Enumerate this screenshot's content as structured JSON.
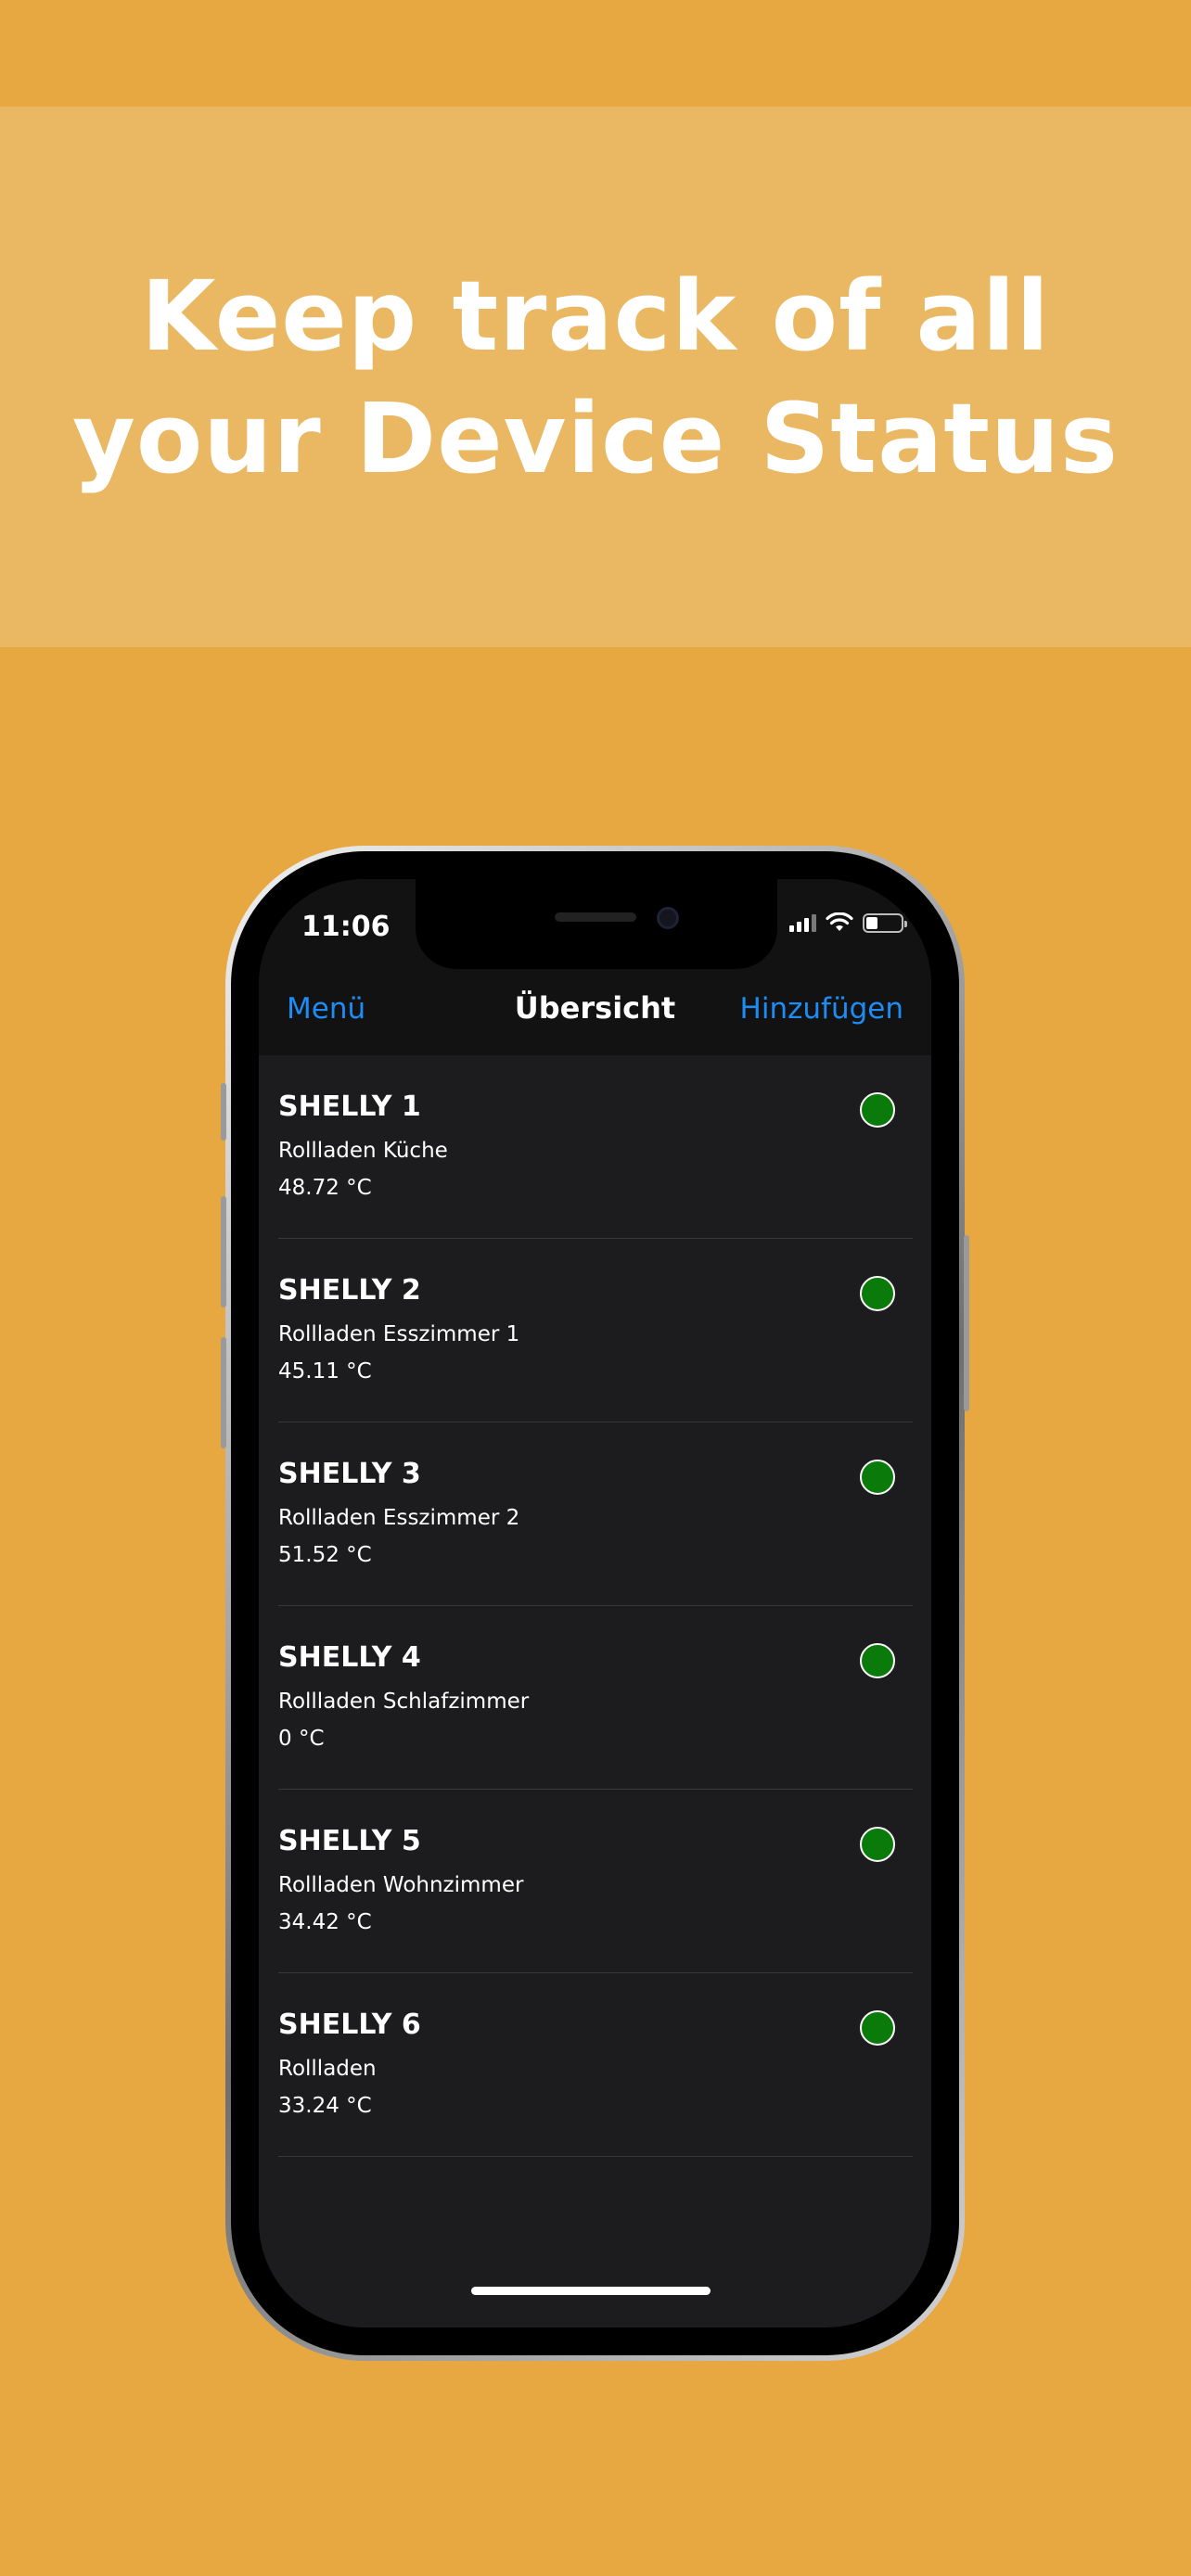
{
  "headline": "Keep track of all\nyour Device Status",
  "status_bar": {
    "time": "11:06"
  },
  "navbar": {
    "left": "Menü",
    "title": "Übersicht",
    "right": "Hinzufügen"
  },
  "devices": [
    {
      "name": "SHELLY 1",
      "room": "Rollladen Küche",
      "temp": "48.72 °C",
      "status": "online"
    },
    {
      "name": "SHELLY 2",
      "room": "Rollladen Esszimmer 1",
      "temp": "45.11 °C",
      "status": "online"
    },
    {
      "name": "SHELLY 3",
      "room": "Rollladen Esszimmer 2",
      "temp": "51.52 °C",
      "status": "online"
    },
    {
      "name": "SHELLY 4",
      "room": "Rollladen Schlafzimmer",
      "temp": "0 °C",
      "status": "online"
    },
    {
      "name": "SHELLY 5",
      "room": "Rollladen Wohnzimmer",
      "temp": "34.42 °C",
      "status": "online"
    },
    {
      "name": "SHELLY 6",
      "room": "Rollladen",
      "temp": "33.24 °C",
      "status": "online"
    }
  ],
  "colors": {
    "background": "#E7A841",
    "banner": "#EAB762",
    "accent": "#1E8CF5",
    "status_online": "#0A7A0A",
    "screen": "#1C1C1E"
  }
}
